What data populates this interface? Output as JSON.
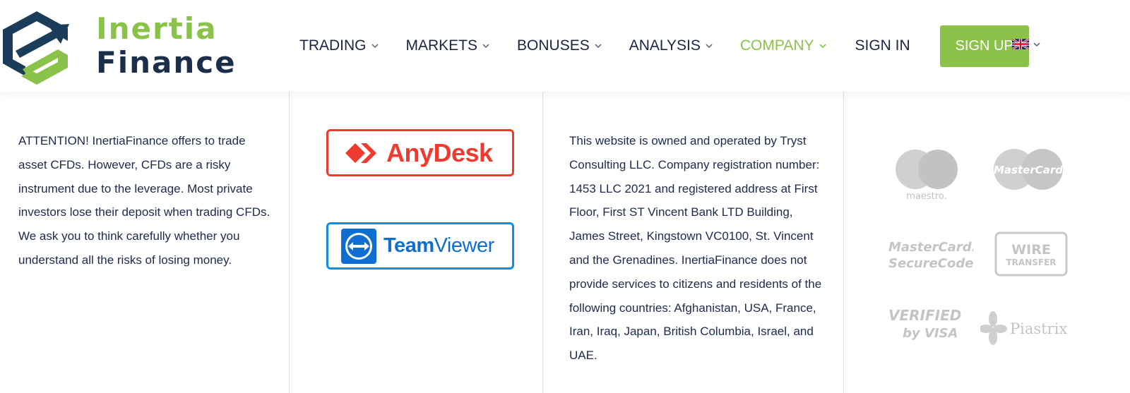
{
  "brand": {
    "line1": "Inertia",
    "line2": "Finance"
  },
  "nav": {
    "items": [
      {
        "label": "TRADING",
        "active": false
      },
      {
        "label": "MARKETS",
        "active": false
      },
      {
        "label": "BONUSES",
        "active": false
      },
      {
        "label": "ANALYSIS",
        "active": false
      },
      {
        "label": "COMPANY",
        "active": true
      }
    ],
    "sign_in": "SIGN IN",
    "sign_up": "SIGN UP",
    "language_icon": "uk-flag-icon"
  },
  "footer": {
    "attention_text": "ATTENTION! InertiaFinance offers to trade asset CFDs. However, CFDs are a risky instrument due to the leverage. Most private investors lose their deposit when trading CFDs. We ask you to think carefully whether you understand all the risks of losing money.",
    "tools": {
      "anydesk": "AnyDesk",
      "teamviewer_bold": "Team",
      "teamviewer_rest": "Viewer"
    },
    "company_text": "This website is owned and operated by Tryst Consulting LLC. Company registration number: 1453 LLC 2021 and registered address at First Floor, First ST Vincent Bank LTD Building, James Street, Kingstown VC0100, St. Vincent and the Grenadines. InertiaFinance does not provide services to citizens and residents of the following countries: Afghanistan, USA, France, Iran, Iraq, Japan, British Columbia, Israel, and UAE.",
    "payments": {
      "maestro": "maestro.",
      "mastercard": "MasterCard",
      "securecode_1": "MasterCard.",
      "securecode_2": "SecureCode.",
      "wire_1": "WIRE",
      "wire_2": "TRANSFER",
      "visa_1": "VERIFIED",
      "visa_2": "by VISA",
      "piastrix": "Piastrix"
    }
  },
  "colors": {
    "accent": "#8bc34a",
    "navy": "#1b2f4a",
    "anydesk_red": "#ef3a2f",
    "teamviewer_blue": "#0e8ee9",
    "payment_gray": "#c8c8c8"
  }
}
